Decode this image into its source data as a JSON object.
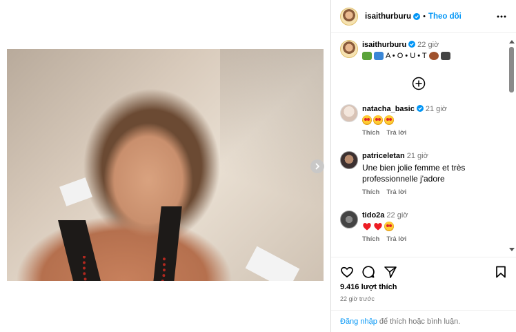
{
  "post": {
    "username": "isaithurburu",
    "dot": "•",
    "follow_label": "Theo dõi",
    "caption_time": "22 giờ",
    "caption_text": "A • O • U • T",
    "caption_icons": [
      "turtle-icon",
      "person-pool-icon",
      "football-icon",
      "tv-icon"
    ]
  },
  "comments": [
    {
      "user": "natacha_basic",
      "verified": true,
      "time": "21 giờ",
      "text": "",
      "emojis": [
        "star-eyes",
        "star-eyes",
        "star-eyes"
      ],
      "like_label": "Thích",
      "reply_label": "Trả lời"
    },
    {
      "user": "patriceletan",
      "verified": false,
      "time": "21 giờ",
      "text": "Une bien jolie femme et très professionnelle j'adore",
      "emojis": [],
      "like_label": "Thích",
      "reply_label": "Trả lời"
    },
    {
      "user": "tido2a",
      "verified": false,
      "time": "22 giờ",
      "text": "",
      "emojis": [
        "heart",
        "heart",
        "star-eyes"
      ],
      "like_label": "Thích",
      "reply_label": "Trả lời"
    }
  ],
  "footer": {
    "likes": "9.416 lượt thích",
    "ago": "22 giờ trước",
    "login_link": "Đăng nhập",
    "login_rest": " để thích hoặc bình luận."
  },
  "colors": {
    "accent": "#0095f6",
    "muted": "#737373",
    "verified": "#0095f6",
    "heart": "#ed1d24"
  }
}
